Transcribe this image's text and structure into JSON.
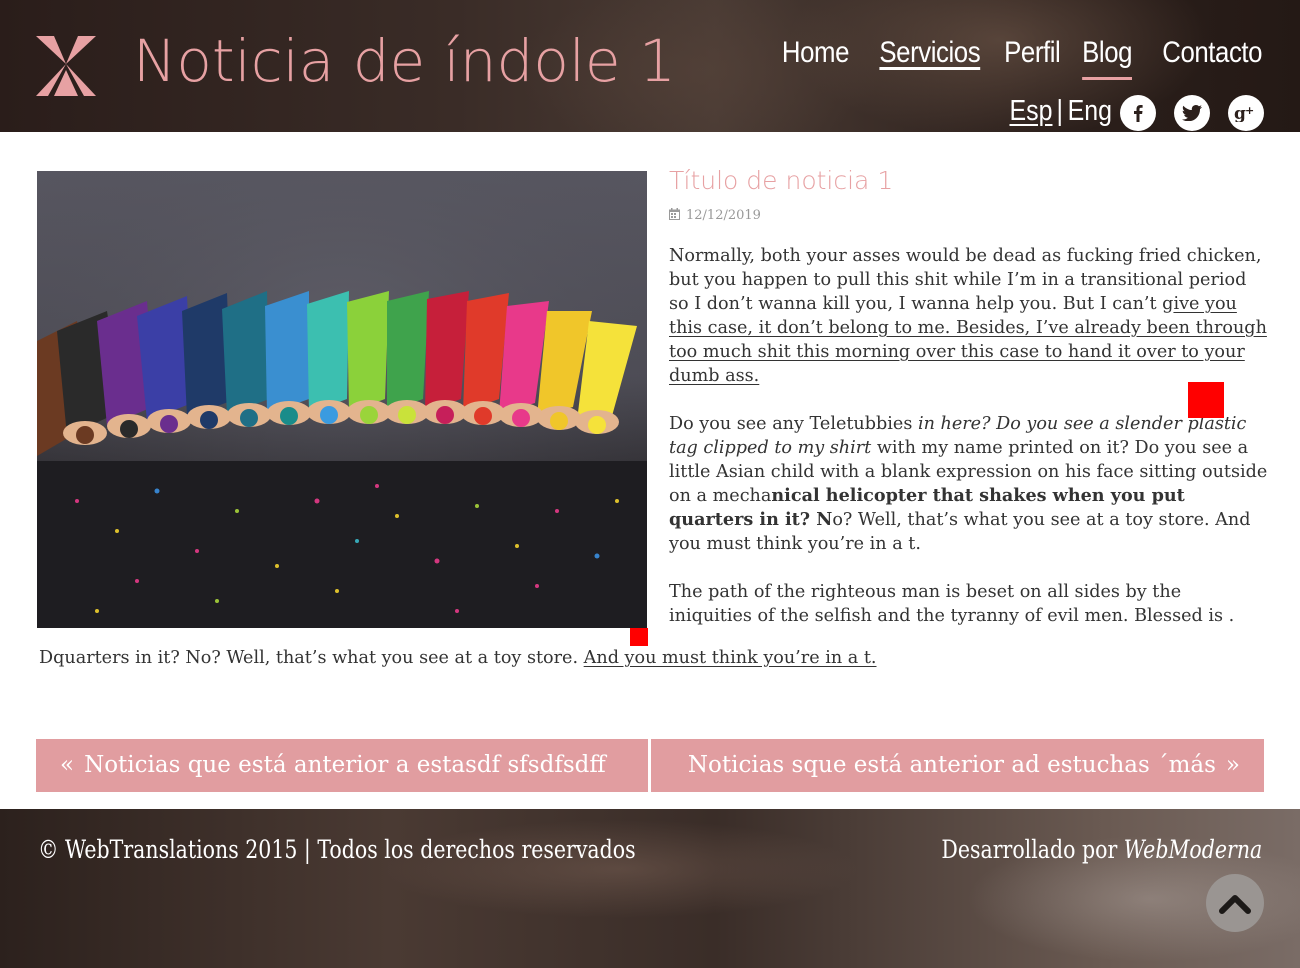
{
  "header": {
    "site_title": "Noticia de índole 1",
    "nav": [
      "Home",
      "Servicios",
      "Perfil",
      "Blog",
      "Contacto"
    ],
    "lang": {
      "esp": "Esp",
      "separator": "|",
      "eng": "Eng"
    },
    "social": [
      "facebook-icon",
      "twitter-icon",
      "google-plus-icon"
    ],
    "accent_color": "#e7a1a3"
  },
  "article": {
    "title": "Título de noticia 1",
    "date": "12/12/2019",
    "p1_a": "Normally, both your asses would be dead as fucking fried chicken, but you happen to pull this shit while I’m in a transitional period so I don’t wanna kill you, I wanna help you. But I can’t g",
    "p1_b": "ive you this case, it don’t belong to me. Besides, I’ve already been through too much shit this morning over this case to hand it over to your dumb ass.",
    "p2_a": "Do you see any Teletubbies ",
    "p2_b": "in here? Do you see a slender plastic tag clipped to my shirt",
    "p2_c": " with my name printed on it? Do you see a little Asian child with a blank expression on his face sitting outside on a mecha",
    "p2_d": "nical helicopter that shakes when you put quarters in it? N",
    "p2_e": "o? Well, that’s what you see at a toy store. And you must think you’re in a t.",
    "p3": "The path of the righteous man is beset on all sides by the iniquities of the selfish and the tyranny of evil men. Blessed is .",
    "tail_a": "Dquarters in it? No? Well, that’s what you see at a toy store. ",
    "tail_b": "And you must think you’re in a t."
  },
  "pager": {
    "prev_arrow": "«",
    "prev_label": "Noticias que está anterior a estasdf sfsdfsdff",
    "next_label": "Noticias sque está anterior ad estuchas ´más",
    "next_arrow": "»",
    "color": "#e19da0"
  },
  "footer": {
    "copyright": "© WebTranslations 2015 | Todos los derechos reservados",
    "developed_by": "Desarrollado por ",
    "developer": "WebModerna"
  }
}
